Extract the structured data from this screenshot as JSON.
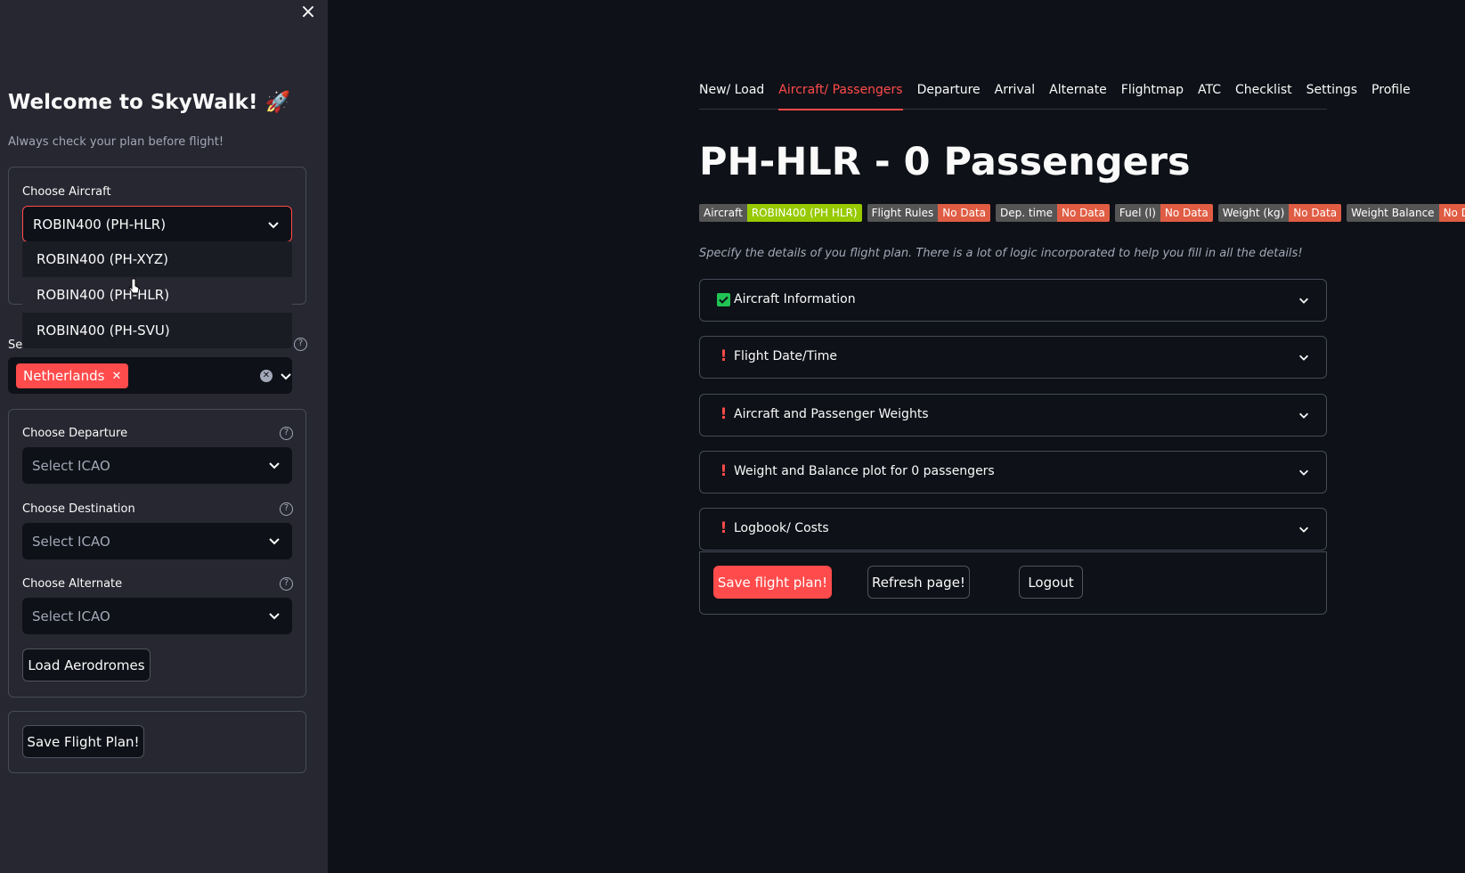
{
  "sidebar": {
    "close": "×",
    "welcome": "Welcome to SkyWalk! 🚀",
    "subtitle": "Always check your plan before flight!",
    "aircraft_label": "Choose Aircraft",
    "aircraft_value": "ROBIN400 (PH-HLR)",
    "aircraft_options": [
      "ROBIN400 (PH-XYZ)",
      "ROBIN400 (PH-HLR)",
      "ROBIN400 (PH-SVU)"
    ],
    "country_label_partial": "Se",
    "country_tag": "Netherlands",
    "departure_label": "Choose Departure",
    "departure_placeholder": "Select ICAO",
    "destination_label": "Choose Destination",
    "destination_placeholder": "Select ICAO",
    "alternate_label": "Choose Alternate",
    "alternate_placeholder": "Select ICAO",
    "load_button": "Load Aerodromes",
    "save_button": "Save Flight Plan!"
  },
  "tabs": [
    "New/ Load",
    "Aircraft/ Passengers",
    "Departure",
    "Arrival",
    "Alternate",
    "Flightmap",
    "ATC",
    "Checklist",
    "Settings",
    "Profile"
  ],
  "active_tab": "Aircraft/ Passengers",
  "main": {
    "title": "PH-HLR - 0 Passengers",
    "badges": [
      {
        "key": "Aircraft",
        "value": "ROBIN400 (PH HLR)",
        "color": "#97ca00"
      },
      {
        "key": "Flight Rules",
        "value": "No Data",
        "color": "#e05d44"
      },
      {
        "key": "Dep. time",
        "value": "No Data",
        "color": "#e05d44"
      },
      {
        "key": "Fuel (l)",
        "value": "No Data",
        "color": "#e05d44"
      },
      {
        "key": "Weight (kg)",
        "value": "No Data",
        "color": "#e05d44"
      },
      {
        "key": "Weight Balance",
        "value": "No Data",
        "color": "#e05d44"
      }
    ],
    "intro": "Specify the details of you flight plan. There is a lot of logic incorporated to help you fill in all the details!",
    "expanders": [
      {
        "title": "Aircraft Information",
        "status": "check-icon"
      },
      {
        "title": "Flight Date/Time",
        "status": "exclamation-icon"
      },
      {
        "title": "Aircraft and Passenger Weights",
        "status": "exclamation-icon"
      },
      {
        "title": "Weight and Balance plot for 0 passengers",
        "status": "exclamation-icon"
      },
      {
        "title": "Logbook/ Costs",
        "status": "exclamation-icon"
      }
    ],
    "save_button": "Save flight plan!",
    "refresh_button": "Refresh page!",
    "logout_button": "Logout"
  },
  "colors": {
    "accent": "#ff4b4b",
    "success": "#21c354",
    "sidebar_bg": "#262730",
    "main_bg": "#0e1117"
  }
}
